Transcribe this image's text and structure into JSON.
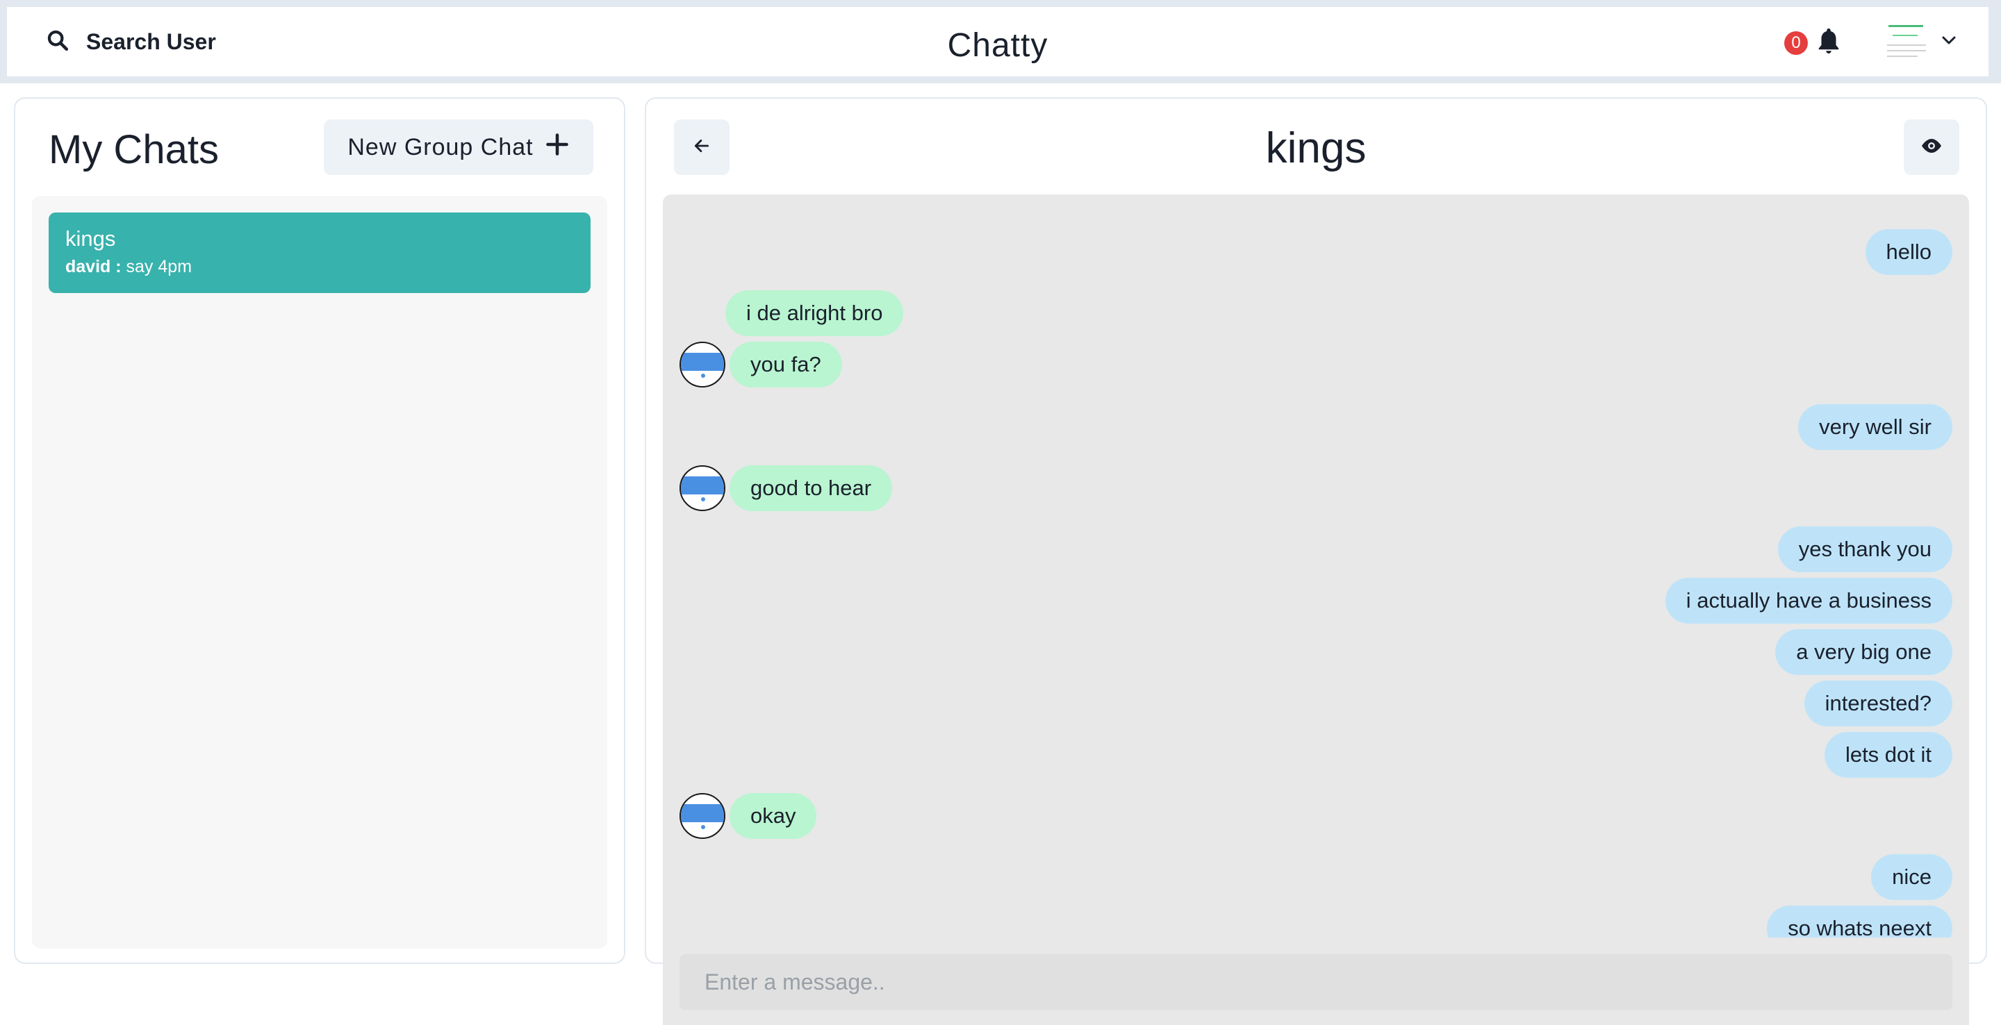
{
  "header": {
    "search_label": "Search User",
    "app_title": "Chatty",
    "notification_count": "0",
    "icons": [
      "search-icon",
      "bell-icon",
      "chevron-down-icon"
    ]
  },
  "sidebar": {
    "title": "My Chats",
    "new_group_label": "New Group Chat",
    "chats": [
      {
        "name": "kings",
        "latest_sender": "david :",
        "latest_message": "say 4pm",
        "selected": true
      }
    ]
  },
  "chat": {
    "title": "kings",
    "input_placeholder": "Enter a message..",
    "messages": [
      {
        "text": "hello",
        "from_me": true
      },
      {
        "text": "i de alright bro",
        "from_me": false
      },
      {
        "text": "you fa?",
        "from_me": false,
        "show_avatar": true
      },
      {
        "text": "very well sir",
        "from_me": true
      },
      {
        "text": "good to hear",
        "from_me": false,
        "show_avatar": true
      },
      {
        "text": "yes thank you",
        "from_me": true
      },
      {
        "text": "i actually have a business",
        "from_me": true
      },
      {
        "text": "a very big one",
        "from_me": true
      },
      {
        "text": "interested?",
        "from_me": true
      },
      {
        "text": "lets dot it",
        "from_me": true
      },
      {
        "text": "okay",
        "from_me": false,
        "show_avatar": true
      },
      {
        "text": "nice",
        "from_me": true
      },
      {
        "text": "so whats neext",
        "from_me": true
      }
    ]
  },
  "colors": {
    "accent": "#38b2ac",
    "my_bubble": "#bee3f8",
    "their_bubble": "#b9f5d0",
    "badge": "#e53e3e"
  }
}
